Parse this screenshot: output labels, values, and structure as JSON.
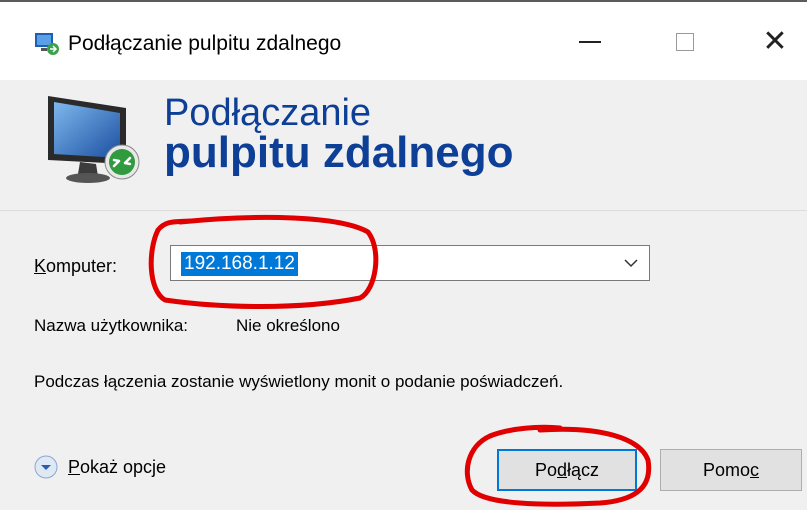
{
  "window": {
    "title": "Podłączanie pulpitu zdalnego",
    "minimize_glyph": "—",
    "close_glyph": "✕"
  },
  "banner": {
    "line1": "Podłączanie",
    "line2": "pulpitu zdalnego"
  },
  "form": {
    "computer_label_first": "K",
    "computer_label_rest": "omputer:",
    "computer_value": "192.168.1.12",
    "username_label": "Nazwa użytkownika:",
    "username_value": "Nie określono",
    "info_text": "Podczas łączenia zostanie wyświetlony monit o podanie poświadczeń."
  },
  "footer": {
    "options_first": "P",
    "options_rest": "okaż opcje",
    "connect_pre": "Po",
    "connect_u": "d",
    "connect_post": "łącz",
    "help_pre": "Pomo",
    "help_u": "c"
  },
  "colors": {
    "banner_text": "#0d3f96",
    "selection": "#0078d7",
    "annotation": "#e00000"
  }
}
